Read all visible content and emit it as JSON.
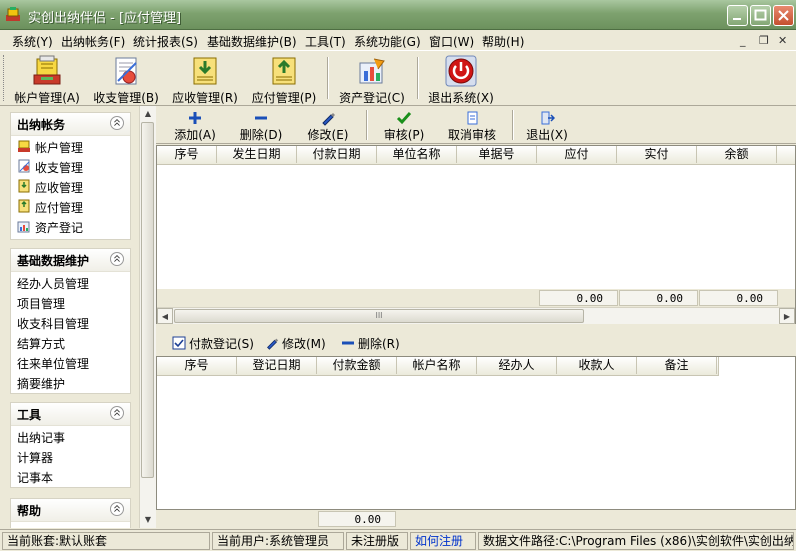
{
  "window": {
    "title": "实创出纳伴侣 - [应付管理]"
  },
  "menu": [
    {
      "label": "系统(Y)"
    },
    {
      "label": "出纳帐务(F)"
    },
    {
      "label": "统计报表(S)"
    },
    {
      "label": "基础数据维护(B)"
    },
    {
      "label": "工具(T)"
    },
    {
      "label": "系统功能(G)"
    },
    {
      "label": "窗口(W)"
    },
    {
      "label": "帮助(H)"
    }
  ],
  "mdi_controls": {
    "minimize": "_",
    "restore": "❐",
    "close": "✕"
  },
  "toolbar": [
    {
      "label": "帐户管理(A)",
      "icon": "account-book-icon"
    },
    {
      "label": "收支管理(B)",
      "icon": "receipt-icon"
    },
    {
      "label": "应收管理(R)",
      "icon": "receivable-icon"
    },
    {
      "label": "应付管理(P)",
      "icon": "payable-icon"
    },
    {
      "label": "资产登记(C)",
      "icon": "asset-icon"
    },
    {
      "label": "退出系统(X)",
      "icon": "power-icon"
    }
  ],
  "nav": {
    "groups": [
      {
        "title": "出纳帐务",
        "items": [
          {
            "label": "帐户管理",
            "icon": "account-book-icon"
          },
          {
            "label": "收支管理",
            "icon": "receipt-icon"
          },
          {
            "label": "应收管理",
            "icon": "receivable-icon"
          },
          {
            "label": "应付管理",
            "icon": "payable-icon"
          },
          {
            "label": "资产登记",
            "icon": "asset-icon"
          }
        ]
      },
      {
        "title": "基础数据维护",
        "items": [
          {
            "label": "经办人员管理"
          },
          {
            "label": "项目管理"
          },
          {
            "label": "收支科目管理"
          },
          {
            "label": "结算方式"
          },
          {
            "label": "往来单位管理"
          },
          {
            "label": "摘要维护"
          }
        ]
      },
      {
        "title": "工具",
        "items": [
          {
            "label": "出纳记事"
          },
          {
            "label": "计算器"
          },
          {
            "label": "记事本"
          }
        ]
      },
      {
        "title": "帮助",
        "items": []
      }
    ]
  },
  "subtoolbar": [
    {
      "label": "添加(A)",
      "icon": "plus-icon"
    },
    {
      "label": "删除(D)",
      "icon": "minus-icon"
    },
    {
      "label": "修改(E)",
      "icon": "pen-icon"
    },
    {
      "label": "审核(P)",
      "icon": "check-icon"
    },
    {
      "label": "取消审核",
      "icon": "document-icon"
    },
    {
      "label": "退出(X)",
      "icon": "exit-door-icon"
    }
  ],
  "upper_table": {
    "columns": [
      "序号",
      "发生日期",
      "付款日期",
      "单位名称",
      "单据号",
      "应付",
      "实付",
      "余额"
    ],
    "totals": [
      "0.00",
      "0.00",
      "0.00"
    ],
    "scroll_grip": "III"
  },
  "lower_toolbar": [
    {
      "label": "付款登记(S)",
      "icon": "checkbox-icon"
    },
    {
      "label": "修改(M)",
      "icon": "pen-icon"
    },
    {
      "label": "删除(R)",
      "icon": "minus-icon"
    }
  ],
  "lower_table": {
    "columns": [
      "序号",
      "登记日期",
      "付款金额",
      "帐户名称",
      "经办人",
      "收款人",
      "备注"
    ],
    "totals": [
      "0.00"
    ]
  },
  "statusbar": {
    "account_set": "当前账套:默认账套",
    "user": "当前用户:系统管理员",
    "registration": "未注册版",
    "register_link": "如何注册",
    "data_path": "数据文件路径:C:\\Program Files (x86)\\实创软件\\实创出纳"
  },
  "colors": {
    "title_bar": "#7ea26f",
    "close_button": "#c4502f",
    "link": "#0033cc",
    "add_icon": "#1a4fb8",
    "check_icon": "#1a8f1a",
    "power_icon": "#cc1111"
  }
}
